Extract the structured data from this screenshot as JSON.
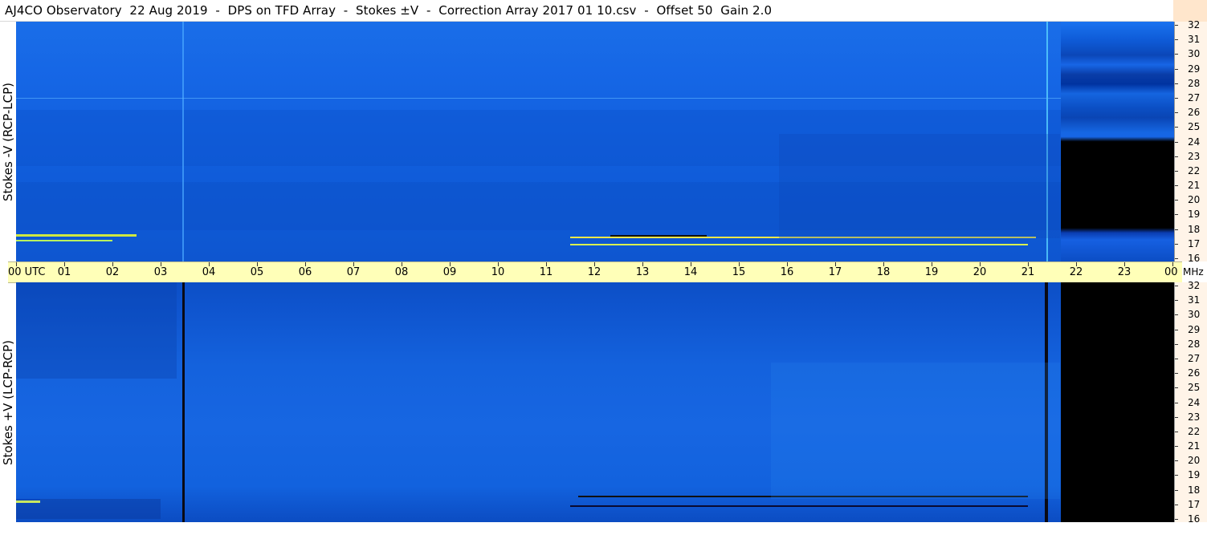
{
  "title": "AJ4CO Observatory  22 Aug 2019  -  DPS on TFD Array  -  Stokes ±V  -  Correction Array 2017 01 10.csv  -  Offset 50  Gain 2.0",
  "panels": {
    "top": {
      "label": "Stokes -V (RCP-LCP)"
    },
    "bottom": {
      "label": "Stokes +V (LCP-RCP)"
    }
  },
  "time_axis": {
    "labels": [
      "00 UTC",
      "01",
      "02",
      "03",
      "04",
      "05",
      "06",
      "07",
      "08",
      "09",
      "10",
      "11",
      "12",
      "13",
      "14",
      "15",
      "16",
      "17",
      "18",
      "19",
      "20",
      "21",
      "22",
      "23",
      "00"
    ],
    "unit": "MHz"
  },
  "frequency_axis": {
    "labels": [
      "32",
      "31",
      "30",
      "29",
      "28",
      "27",
      "26",
      "25",
      "24",
      "23",
      "22",
      "21",
      "20",
      "19",
      "18",
      "17",
      "16"
    ]
  },
  "colors": {
    "spectrogram_blue": "#1466e0",
    "axis_background": "#ffffb8",
    "scale_background": "#fff4e8",
    "no_data": "#000000"
  }
}
